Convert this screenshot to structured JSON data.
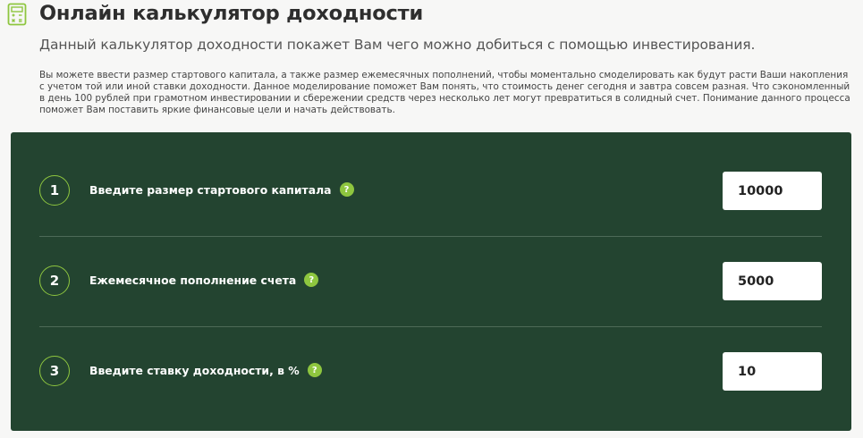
{
  "header": {
    "icon": "calculator-icon",
    "title": "Онлайн калькулятор доходности",
    "subtitle": "Данный калькулятор доходности покажет Вам чего можно добиться с помощью инвестирования.",
    "description": "Вы можете ввести размер стартового капитала, а также размер ежемесячных пополнений, чтобы моментально смоделировать как будут расти Ваши накопления с учетом той или иной ставки доходности. Данное моделирование поможет Вам понять, что стоимость денег сегодня и завтра совсем разная. Что сэкономленный в день 100 рублей при грамотном инвестировании и сбережении средств через несколько лет могут превратиться в солидный счет. Понимание данного процесса поможет Вам поставить яркие финансовые цели и начать действовать."
  },
  "calculator": {
    "rows": [
      {
        "step": "1",
        "label": "Введите размер стартового капитала",
        "help": "?",
        "value": "10000"
      },
      {
        "step": "2",
        "label": "Ежемесячное пополнение счета",
        "help": "?",
        "value": "5000"
      },
      {
        "step": "3",
        "label": "Введите ставку доходности, в %",
        "help": "?",
        "value": "10"
      }
    ]
  },
  "colors": {
    "panel_background": "#234430",
    "accent_green": "#8ec63f",
    "page_background": "#f7f7f6"
  }
}
